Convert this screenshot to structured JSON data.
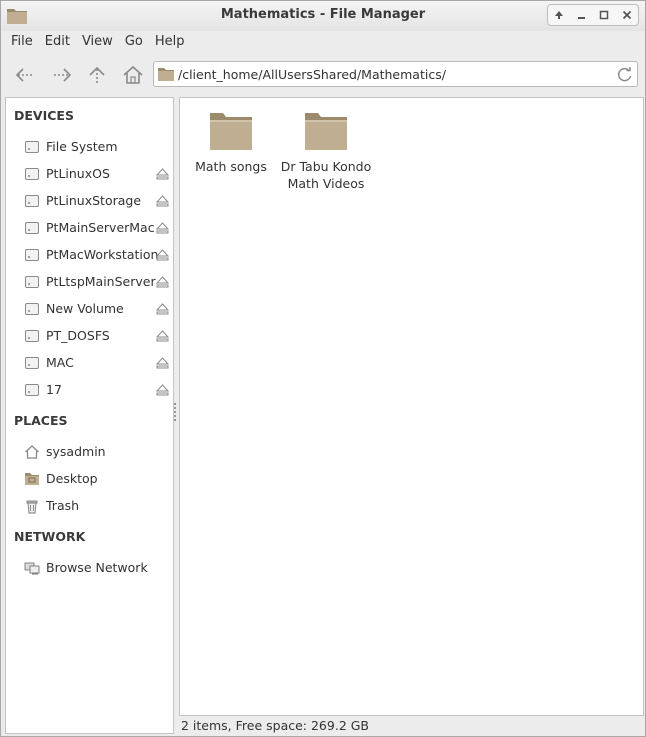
{
  "window": {
    "title": "Mathematics - File Manager"
  },
  "menubar": {
    "items": [
      "File",
      "Edit",
      "View",
      "Go",
      "Help"
    ]
  },
  "toolbar": {
    "back_icon": "back-arrow-icon",
    "forward_icon": "forward-arrow-icon",
    "up_icon": "up-arrow-icon",
    "home_icon": "home-icon",
    "location": "/client_home/AllUsersShared/Mathematics/",
    "reload_icon": "reload-icon"
  },
  "sidebar": {
    "devices_header": "DEVICES",
    "devices": [
      {
        "label": "File System",
        "eject": false
      },
      {
        "label": "PtLinuxOS",
        "eject": true
      },
      {
        "label": "PtLinuxStorage",
        "eject": true
      },
      {
        "label": "PtMainServerMac",
        "eject": true
      },
      {
        "label": "PtMacWorkstation",
        "eject": true
      },
      {
        "label": "PtLtspMainServer",
        "eject": true
      },
      {
        "label": "New Volume",
        "eject": true
      },
      {
        "label": "PT_DOSFS",
        "eject": true
      },
      {
        "label": "MAC",
        "eject": true
      },
      {
        "label": "17",
        "eject": true
      }
    ],
    "places_header": "PLACES",
    "places": [
      {
        "label": "sysadmin",
        "icon": "home-icon"
      },
      {
        "label": "Desktop",
        "icon": "desktop-folder-icon"
      },
      {
        "label": "Trash",
        "icon": "trash-icon"
      }
    ],
    "network_header": "NETWORK",
    "network": [
      {
        "label": "Browse Network",
        "icon": "network-icon"
      }
    ]
  },
  "files": [
    {
      "line1": "Math songs",
      "line2": ""
    },
    {
      "line1": "Dr Tabu Kondo",
      "line2": "Math Videos"
    }
  ],
  "status": "2 items, Free space: 269.2 GB",
  "colors": {
    "folder": "#bfae92",
    "folder_dark": "#9c8a6c",
    "window_bg": "#ececec"
  }
}
